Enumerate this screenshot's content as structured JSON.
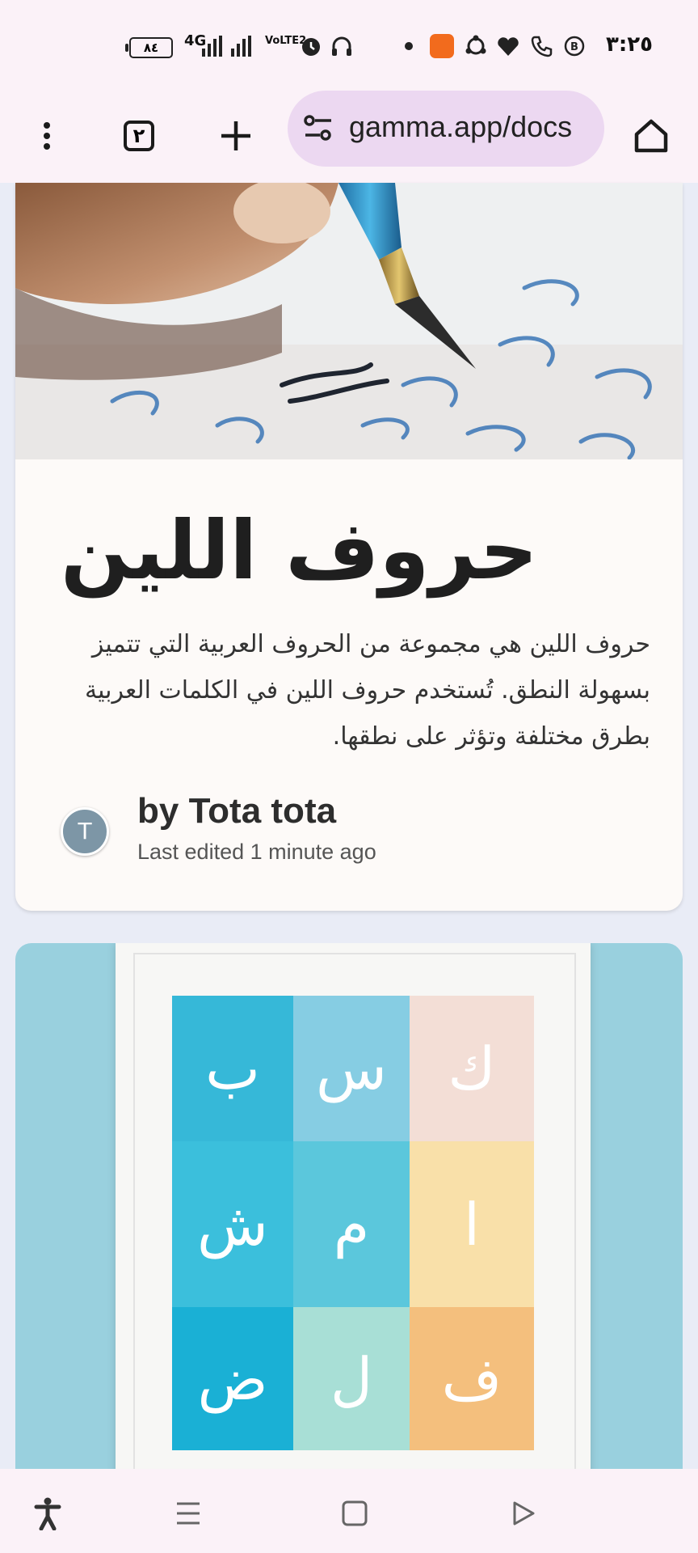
{
  "status_bar": {
    "time": "٣:٢٥",
    "battery": "٨٤",
    "network": "4G",
    "volte": "VoLTE2"
  },
  "browser": {
    "url": "gamma.app/docs",
    "tab_count": "٢",
    "icons": [
      "menu-dots-icon",
      "tabs-icon",
      "new-tab-icon",
      "site-settings-icon",
      "home-icon"
    ]
  },
  "doc": {
    "title": "حروف اللين",
    "description": "حروف اللين هي مجموعة من الحروف العربية التي تتميز بسهولة النطق. تُستخدم حروف اللين في الكلمات العربية بطرق مختلفة وتؤثر على نطقها.",
    "author_initial": "T",
    "author_line": "by Tota tota",
    "edited": "Last edited 1 minute ago"
  },
  "poster": {
    "letters": [
      "ب",
      "س",
      "ك",
      "ش",
      "م",
      "ا",
      "ض",
      "ل",
      "ف"
    ],
    "colors": [
      "#36b8d8",
      "#86cde3",
      "#f3ded6",
      "#3bbfdc",
      "#5bc7dc",
      "#f9e0a9",
      "#1ab0d5",
      "#a8dfd6",
      "#f4bf7d"
    ]
  },
  "navbar": {
    "icons": [
      "accessibility-icon",
      "recents-icon",
      "home-square-icon",
      "back-triangle-icon"
    ]
  }
}
